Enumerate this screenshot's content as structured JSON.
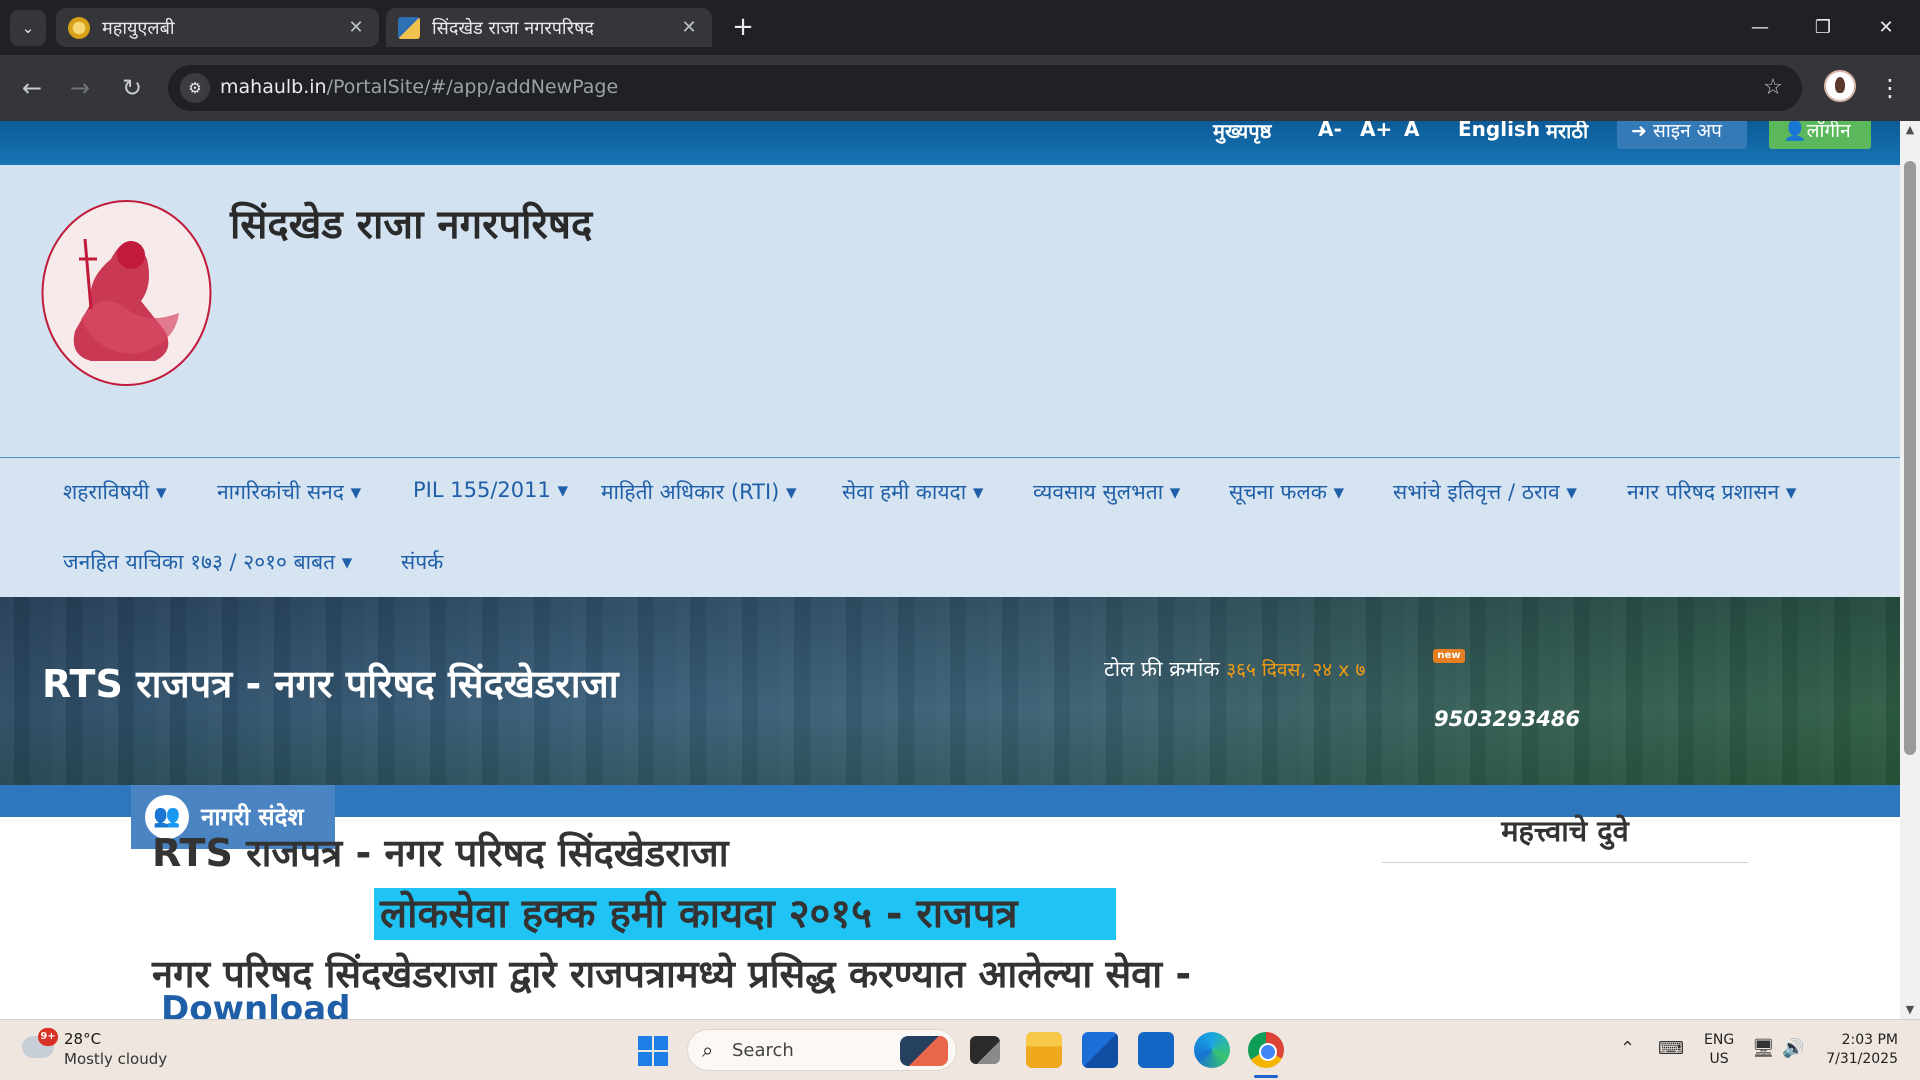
{
  "browser": {
    "tabs": [
      {
        "title": "महायुएलबी",
        "active": false
      },
      {
        "title": "सिंदखेड राजा नगरपरिषद",
        "active": true
      }
    ],
    "address": {
      "host": "mahaulb.in",
      "path": "/PortalSite/#/app/addNewPage"
    }
  },
  "page": {
    "top_links": {
      "home": "मुख्यपृष्ठ",
      "font_smaller": "A-",
      "font_larger": "A+",
      "font_normal": "A",
      "english": "English",
      "marathi": "मराठी",
      "signup": "साइन अप",
      "login": "लॉगीन"
    },
    "site_title": "सिंदखेड राजा नगरपरिषद",
    "menu": [
      "शहराविषयी ▾",
      "नागरिकांची सनद ▾",
      "PIL 155/2011 ▾",
      "माहिती अधिकार (RTI) ▾",
      "सेवा हमी कायदा ▾",
      "व्यवसाय सुलभता ▾",
      "सूचना फलक ▾",
      "सभांचे इतिवृत्त / ठराव ▾",
      "नगर परिषद प्रशासन ▾",
      "जनहित याचिका १७३ / २०१० बाबत ▾",
      "संपर्क"
    ],
    "banner": {
      "title": "RTS राजपत्र - नगर परिषद सिंदखेडराजा",
      "toll_label": "टोल फ्री क्रमांक",
      "toll_hours": "३६५ दिवस, २४ x ७",
      "new_badge": "new",
      "phone": "9503293486"
    },
    "nagari_label": "नागरी संदेश",
    "content": {
      "heading": "RTS राजपत्र - नगर परिषद सिंदखेडराजा",
      "highlight": "लोकसेवा हक्क हमी कायदा २०१५ - राजपत्र",
      "paragraph": "नगर परिषद सिंदखेडराजा द्वारे राजपत्रामध्ये प्रसिद्ध करण्यात आलेल्या सेवा -",
      "download": "Download"
    },
    "sidebar_title": "महत्त्वाचे दुवे"
  },
  "taskbar": {
    "weather_badge": "9+",
    "temperature": "28°C",
    "condition": "Mostly cloudy",
    "search_label": "Search",
    "lang_line1": "ENG",
    "lang_line2": "US",
    "time": "2:03 PM",
    "date": "7/31/2025"
  },
  "colors": {
    "header_bg": "#d3e2f0",
    "menu_link": "#1f5fa8",
    "highlight": "#20c4f4",
    "login_green": "#5cb85c",
    "signup_blue": "#337ab7"
  }
}
